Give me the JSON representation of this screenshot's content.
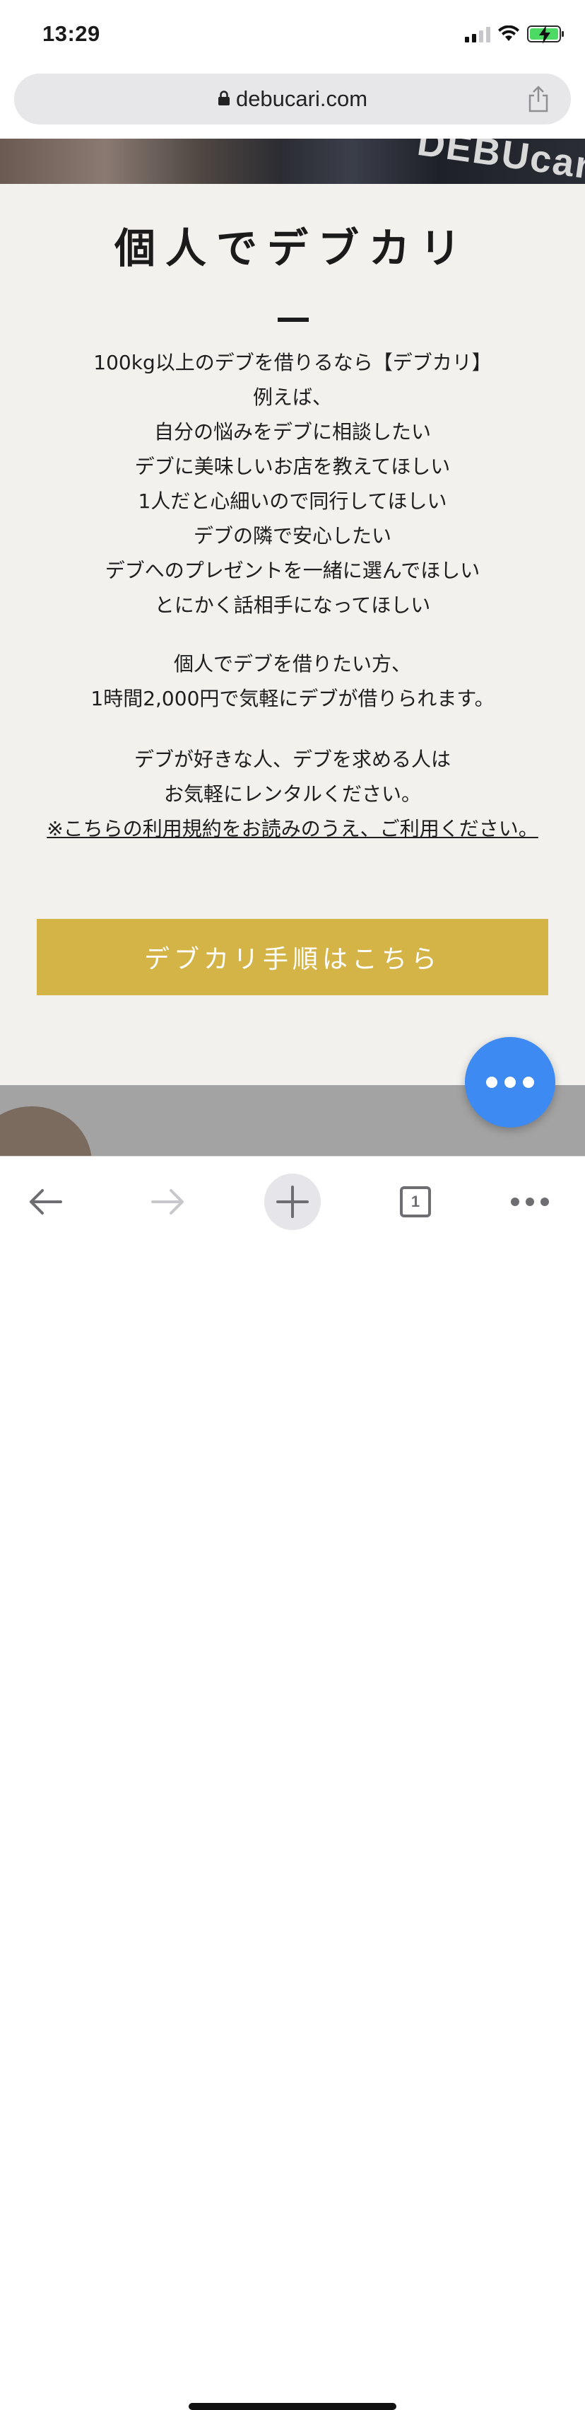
{
  "status_bar": {
    "time": "13:29"
  },
  "browser": {
    "url": "debucari.com"
  },
  "hero": {
    "logo_text": "DEBUcari"
  },
  "section": {
    "title": "個人でデブカリ",
    "intro_lines": [
      "100kg以上のデブを借りるなら【デブカリ】",
      "例えば、",
      "自分の悩みをデブに相談したい",
      "デブに美味しいお店を教えてほしい",
      "1人だと心細いので同行してほしい",
      "デブの隣で安心したい",
      "デブへのプレゼントを一緒に選んでほしい",
      "とにかく話相手になってほしい"
    ],
    "price_lines": [
      "個人でデブを借りたい方、",
      "1時間2,000円で気軽にデブが借りられます。"
    ],
    "invite_lines": [
      "デブが好きな人、デブを求める人は",
      "お気軽にレンタルください。"
    ],
    "terms_link": "※こちらの利用規約をお読みのうえ、ご利用ください。",
    "cta_label": "デブカリ手順はこちら"
  },
  "fab": {
    "icon": "more-dots-icon"
  },
  "toolbar": {
    "tab_count": "1"
  },
  "colors": {
    "accent": "#d4b447",
    "fab": "#3d8bf2",
    "background": "#f2f1ee"
  }
}
